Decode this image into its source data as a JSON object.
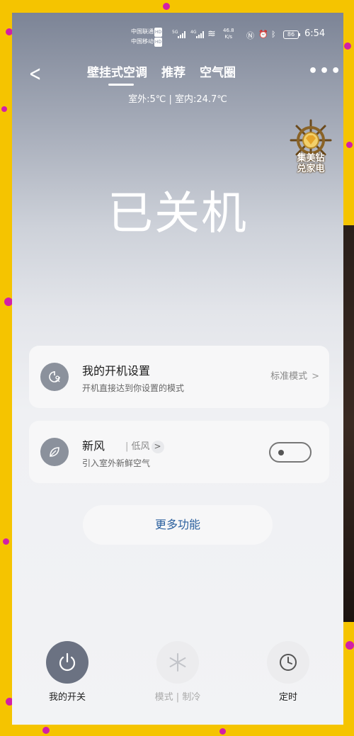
{
  "status_bar": {
    "carrier1": "中国联通",
    "carrier2": "中国移动",
    "hd": "HD",
    "net1": "5G",
    "net2": "4G",
    "speed_value": "46.8",
    "speed_unit": "K/s",
    "battery": "86",
    "time": "6:54"
  },
  "header": {
    "tabs": [
      {
        "label": "壁挂式空调",
        "active": true
      },
      {
        "label": "推荐"
      },
      {
        "label": "空气圈"
      }
    ],
    "more_icon": "more-dots-icon",
    "back_icon": "chevron-left-icon",
    "temperatures": "室外:5℃ | 室内:24.7℃"
  },
  "badge": {
    "line1": "集美钻",
    "line2": "兑家电"
  },
  "power_state": "已关机",
  "cards": {
    "startup": {
      "title": "我的开机设置",
      "subtitle": "开机直接达到你设置的模式",
      "value": "标准模式"
    },
    "fresh_air": {
      "title": "新风",
      "tag": "低风",
      "subtitle": "引入室外新鲜空气",
      "toggle_on": false
    }
  },
  "more_functions": "更多功能",
  "bottom_nav": {
    "power": "我的开关",
    "mode": "模式 | 制冷",
    "timer": "定时"
  },
  "colors": {
    "frame": "#f5c400",
    "confetti": "#d21fa8",
    "icon_circle": "#8b919c",
    "power_button": "#6b7282",
    "link_blue": "#2a5f9e"
  }
}
